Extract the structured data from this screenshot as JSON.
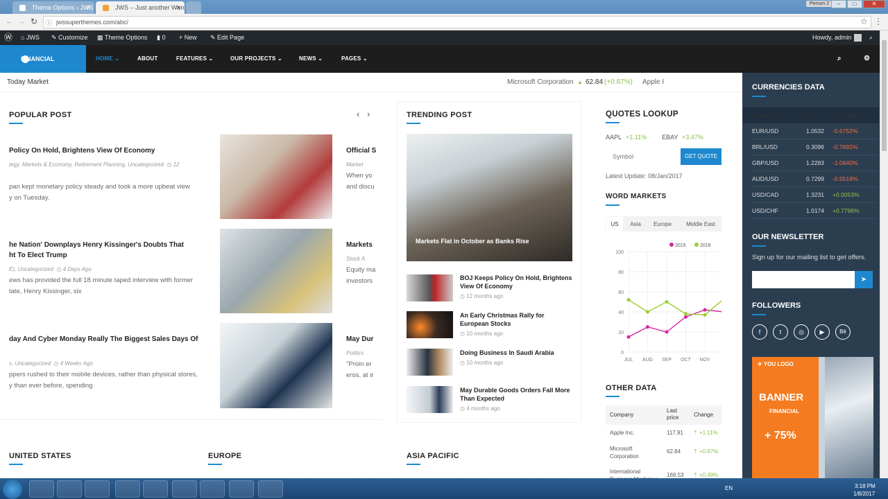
{
  "browser": {
    "tabs": [
      {
        "title": "Theme Options ‹ JWS —"
      },
      {
        "title": "JWS – Just another Word"
      }
    ],
    "url": "jwssuperthemes.com/abc/",
    "profile": "Person 2"
  },
  "adminbar": {
    "site": "JWS",
    "customize": "Customize",
    "theme_options": "Theme Options",
    "comments": "0",
    "new": "New",
    "edit": "Edit Page",
    "howdy": "Howdy, admin"
  },
  "header": {
    "logo": "FINANCIAL",
    "nav": [
      "HOME",
      "ABOUT",
      "FEATURES",
      "OUR PROJECTS",
      "NEWS",
      "PAGES"
    ]
  },
  "ticker": {
    "label": "Today Market",
    "company": "Microsoft Corporation",
    "price": "62.84",
    "change": "(+0.87%)",
    "next": "Apple I"
  },
  "popular": {
    "title": "POPULAR POST",
    "posts": [
      {
        "title": "Policy On Hold, Brightens View Of Economy",
        "meta": "tegy, Markets & Economy, Retirement Planning, Uncategorized",
        "count": "12",
        "excerpt1": "pan kept monetary policy steady and took a more upbeat view",
        "excerpt2": "y on Tuesday."
      },
      {
        "title1": "he Nation' Downplays Henry Kissinger's Doubts That",
        "title2": "ht To Elect Trump",
        "meta": "E), Uncategorized",
        "time": "4 Days Ago",
        "excerpt1": "ews has provided the full 18 minute taped interview with former",
        "excerpt2": "tate, Henry Kissinger, six"
      },
      {
        "title": "day And Cyber Monday Really The Biggest Sales Days Of",
        "meta": "s, Uncategorized",
        "time": "4 Weeks Ago",
        "excerpt1": "ppers rushed to their mobile devices, rather than physical stores,",
        "excerpt2": "y than ever before, spending"
      }
    ],
    "right": [
      {
        "title": "Official S",
        "meta": "Market",
        "ex1": "When yo",
        "ex2": "and discu"
      },
      {
        "title": "Markets",
        "meta": "Stock A",
        "ex1": "Equity ma",
        "ex2": "investors"
      },
      {
        "title": "May Dur",
        "meta": "Politics",
        "ex1": "\"Proin er",
        "ex2": "eros, at ir"
      }
    ]
  },
  "trending": {
    "title": "TRENDING POST",
    "hero": "Markets Flat in October as Banks Rise",
    "items": [
      {
        "title1": "BOJ Keeps Policy On Hold, Brightens",
        "title2": "View Of Economy",
        "time": "12 months ago"
      },
      {
        "title1": "An Early Christmas Rally for",
        "title2": "European Stocks",
        "time": "10 months ago"
      },
      {
        "title1": "Doing Business In Saudi Arabia",
        "title2": "",
        "time": "10 months ago"
      },
      {
        "title1": "May Durable Goods Orders Fall More",
        "title2": "Than Expected",
        "time": "4 months ago"
      }
    ]
  },
  "quotes": {
    "title": "QUOTES LOOKUP",
    "aapl": "AAPL",
    "aapl_ch": "+1.11%",
    "ebay": "EBAY",
    "ebay_ch": "+3.47%",
    "placeholder": "Symbol",
    "button": "GET QUOTE",
    "update": "Latest Update: 08/Jan/2017"
  },
  "word": {
    "title": "WORD MARKETS",
    "tabs": [
      "US",
      "Asia",
      "Europe",
      "Middle East"
    ]
  },
  "chart_data": {
    "type": "line",
    "categories": [
      "JUL",
      "AUG",
      "SEP",
      "OCT",
      "NOV",
      "D"
    ],
    "ylim": [
      0,
      100
    ],
    "yticks": [
      0,
      20,
      40,
      60,
      80,
      100
    ],
    "series": [
      {
        "name": "2015",
        "color": "#d6249f",
        "values": [
          15,
          25,
          20,
          35,
          42,
          40
        ]
      },
      {
        "name": "2016",
        "color": "#9acd32",
        "values": [
          52,
          40,
          50,
          38,
          37,
          53
        ]
      }
    ]
  },
  "other": {
    "title": "OTHER DATA",
    "headers": [
      "Company",
      "Last price",
      "Change"
    ],
    "rows": [
      [
        "Apple Inc.",
        "117.91",
        "+1.11%"
      ],
      [
        "Microsoft Corporation",
        "62.84",
        "+0.87%"
      ],
      [
        "International Business Machines",
        "169.53",
        "+0.49%"
      ]
    ]
  },
  "currencies": {
    "title": "CURRENCIES DATA",
    "headers": [
      "Currency Pair",
      "Price",
      "% Change"
    ],
    "rows": [
      [
        "EUR/USD",
        "1.0532",
        "-0.6752%"
      ],
      [
        "BRL/USD",
        "0.3096",
        "-0.7692%"
      ],
      [
        "GBP/USD",
        "1.2283",
        "-1.0840%"
      ],
      [
        "AUD/USD",
        "0.7299",
        "-0.5518%"
      ],
      [
        "USD/CAD",
        "1.3231",
        "+0.0053%"
      ],
      [
        "USD/CHF",
        "1.0174",
        "+0.7796%"
      ]
    ]
  },
  "newsletter": {
    "title": "OUR NEWSLETTER",
    "text": "Sign up for our mailing list to get offers."
  },
  "followers": {
    "title": "FOLLOWERS",
    "icons": [
      "f",
      "t",
      "◎",
      "▶",
      "Bē"
    ]
  },
  "banner": {
    "logo": "YOU LOGO",
    "word": "BANNER",
    "sub": "FINANCIAL",
    "pct": "+ 75%"
  },
  "bottom": [
    "UNITED STATES",
    "EUROPE",
    "ASIA PACIFIC"
  ],
  "taskbar": {
    "lang": "EN",
    "time": "3:18 PM",
    "date": "1/8/2017"
  },
  "colors": {
    "accent": "#1e88cf",
    "positive": "#8bc34a",
    "negative": "#ff6a3d"
  }
}
